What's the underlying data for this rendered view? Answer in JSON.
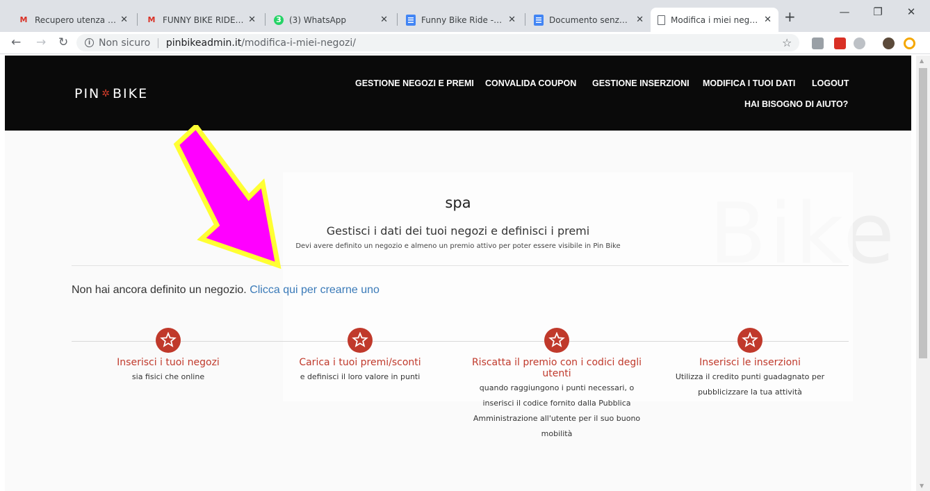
{
  "browser": {
    "tabs": [
      {
        "title": "Recupero utenza e pass",
        "favicon": "gmail-icon",
        "active": false
      },
      {
        "title": "FUNNY BIKE RIDE - pin",
        "favicon": "gmail-icon",
        "active": false
      },
      {
        "title": "(3) WhatsApp",
        "favicon": "whatsapp-icon",
        "active": false
      },
      {
        "title": "Funny Bike Ride - Milan",
        "favicon": "docs-icon",
        "active": false
      },
      {
        "title": "Documento senza titolo",
        "favicon": "docs-icon",
        "active": false
      },
      {
        "title": "Modifica i miei negozi -",
        "favicon": "page-icon",
        "active": true
      }
    ],
    "whatsapp_badge": "3",
    "security_label": "Non sicuro",
    "url_host": "pinbikeadmin.it",
    "url_path": "/modifica-i-miei-negozi/"
  },
  "site": {
    "logo_left": "PIN",
    "logo_right": "BIKE",
    "nav": {
      "gestione_negozi": "GESTIONE NEGOZI E PREMI",
      "convalida_coupon": "CONVALIDA COUPON",
      "gestione_inserzioni": "GESTIONE INSERZIONI",
      "modifica_dati": "MODIFICA I TUOI DATI",
      "logout": "LOGOUT",
      "aiuto": "HAI BISOGNO DI AIUTO?"
    },
    "watermark": "Bike",
    "page_title": "spa",
    "subtitle": "Gestisci i dati dei tuoi negozi e definisci i premi",
    "note": "Devi avere definito un negozio e almeno un premio attivo per poter essere visibile in Pin Bike",
    "message_text": "Non hai ancora definito un negozio.",
    "message_link": "Clicca qui per crearne uno",
    "steps": [
      {
        "title": "Inserisci i tuoi negozi",
        "desc": "sia fisici che online"
      },
      {
        "title": "Carica i tuoi premi/sconti",
        "desc": "e definisci il loro valore in punti"
      },
      {
        "title": "Riscatta il premio con i codici degli utenti",
        "desc": "quando raggiungono i punti necessari, o inserisci il codice fornito dalla Pubblica Amministrazione all'utente per il suo buono mobilità"
      },
      {
        "title": "Inserisci le inserzioni",
        "desc": "Utilizza il credito punti guadagnato per pubblicizzare la tua attività"
      }
    ]
  },
  "colors": {
    "brand_red": "#c0392b",
    "link_blue": "#3a7ab8",
    "annotation_arrow": "#ff00ff",
    "annotation_outline": "#ffff33"
  }
}
